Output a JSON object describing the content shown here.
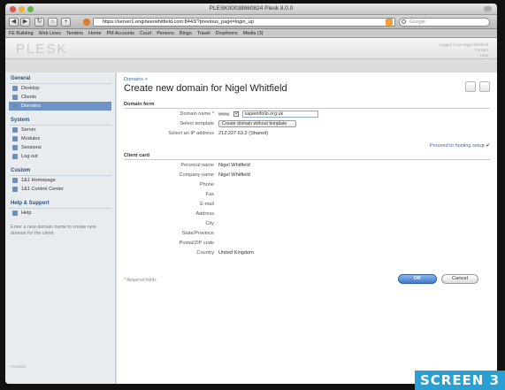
{
  "window": {
    "title": "PLESK00038860824 Plesk 8.0.0"
  },
  "toolbar": {
    "url": "https://server1.engineerwhitfield.com:8443/?previous_page=login_up",
    "search_placeholder": "Google"
  },
  "bookmarks": [
    "FE Building",
    "Web Lines",
    "Tenders",
    "Home",
    "PM Accounts",
    "Court",
    "Persons",
    "Bingo",
    "Travel",
    "Dropforms",
    "Media (3)"
  ],
  "header": {
    "logo": "PLESK",
    "right_lines": [
      "Logged in as Nigel Whitfield",
      "Contact",
      "Help"
    ]
  },
  "sidebar": {
    "groups": [
      {
        "title": "General",
        "items": [
          {
            "label": "Desktop",
            "icon": "desktop-icon",
            "active": false
          },
          {
            "label": "Clients",
            "icon": "clients-icon",
            "active": false
          },
          {
            "label": "Domains",
            "icon": "domains-icon",
            "active": true
          }
        ]
      },
      {
        "title": "System",
        "items": [
          {
            "label": "Server",
            "icon": "server-icon",
            "active": false
          },
          {
            "label": "Modules",
            "icon": "modules-icon",
            "active": false
          },
          {
            "label": "Sessions",
            "icon": "sessions-icon",
            "active": false
          },
          {
            "label": "Log out",
            "icon": "logout-icon",
            "active": false
          }
        ]
      },
      {
        "title": "Custom",
        "items": [
          {
            "label": "1&1 Homepage",
            "icon": "link-icon",
            "active": false
          },
          {
            "label": "1&1 Control Center",
            "icon": "link-icon",
            "active": false
          }
        ]
      },
      {
        "title": "Help & Support",
        "items": [
          {
            "label": "Help",
            "icon": "help-icon",
            "active": false
          }
        ]
      }
    ],
    "hint": "Enter a new domain name to create new domain for the client.",
    "footer": "Parallels"
  },
  "main": {
    "breadcrumb": "Domains >",
    "title": "Create new domain for Nigel Whitfield",
    "domain_form": {
      "heading": "Domain form",
      "domain_name_label": "Domain name *",
      "www_label": "www.",
      "domain_name_value": "sapientfolio.org.uk",
      "template_label": "Select template",
      "template_value": "Create domain without template",
      "ip_label": "Select an IP address",
      "ip_value": "212.227.63.2 (Shared)"
    },
    "proceed_link": "Proceed to hosting setup",
    "client_card": {
      "heading": "Client card",
      "rows": [
        {
          "label": "Personal name",
          "value": "Nigel Whitfield"
        },
        {
          "label": "Company name",
          "value": "Nigel Whitfield"
        },
        {
          "label": "Phone",
          "value": ""
        },
        {
          "label": "Fax",
          "value": ""
        },
        {
          "label": "E-mail",
          "value": ""
        },
        {
          "label": "Address",
          "value": ""
        },
        {
          "label": "City",
          "value": ""
        },
        {
          "label": "State/Province",
          "value": ""
        },
        {
          "label": "Postal/ZIP code",
          "value": ""
        },
        {
          "label": "Country",
          "value": "United Kingdom"
        }
      ]
    },
    "required_note": "* Required fields",
    "ok_label": "OK",
    "cancel_label": "Cancel"
  },
  "caption": "SCREEN 3",
  "colors": {
    "accent": "#6e93c7",
    "caption_bg": "#2a9fd4"
  }
}
